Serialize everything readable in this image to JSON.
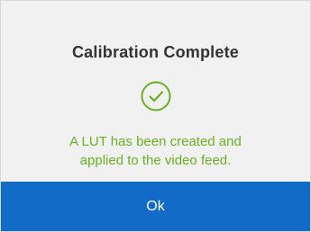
{
  "dialog": {
    "title": "Calibration Complete",
    "icon": "check-circle-icon",
    "message_lines": [
      "A LUT has been created and",
      "applied to the video feed."
    ],
    "ok_label": "Ok"
  },
  "colors": {
    "background": "#f1f1f1",
    "success_green": "#6ab023",
    "button_blue": "#116bc7",
    "title_text": "#333333",
    "button_text": "#ffffff"
  }
}
